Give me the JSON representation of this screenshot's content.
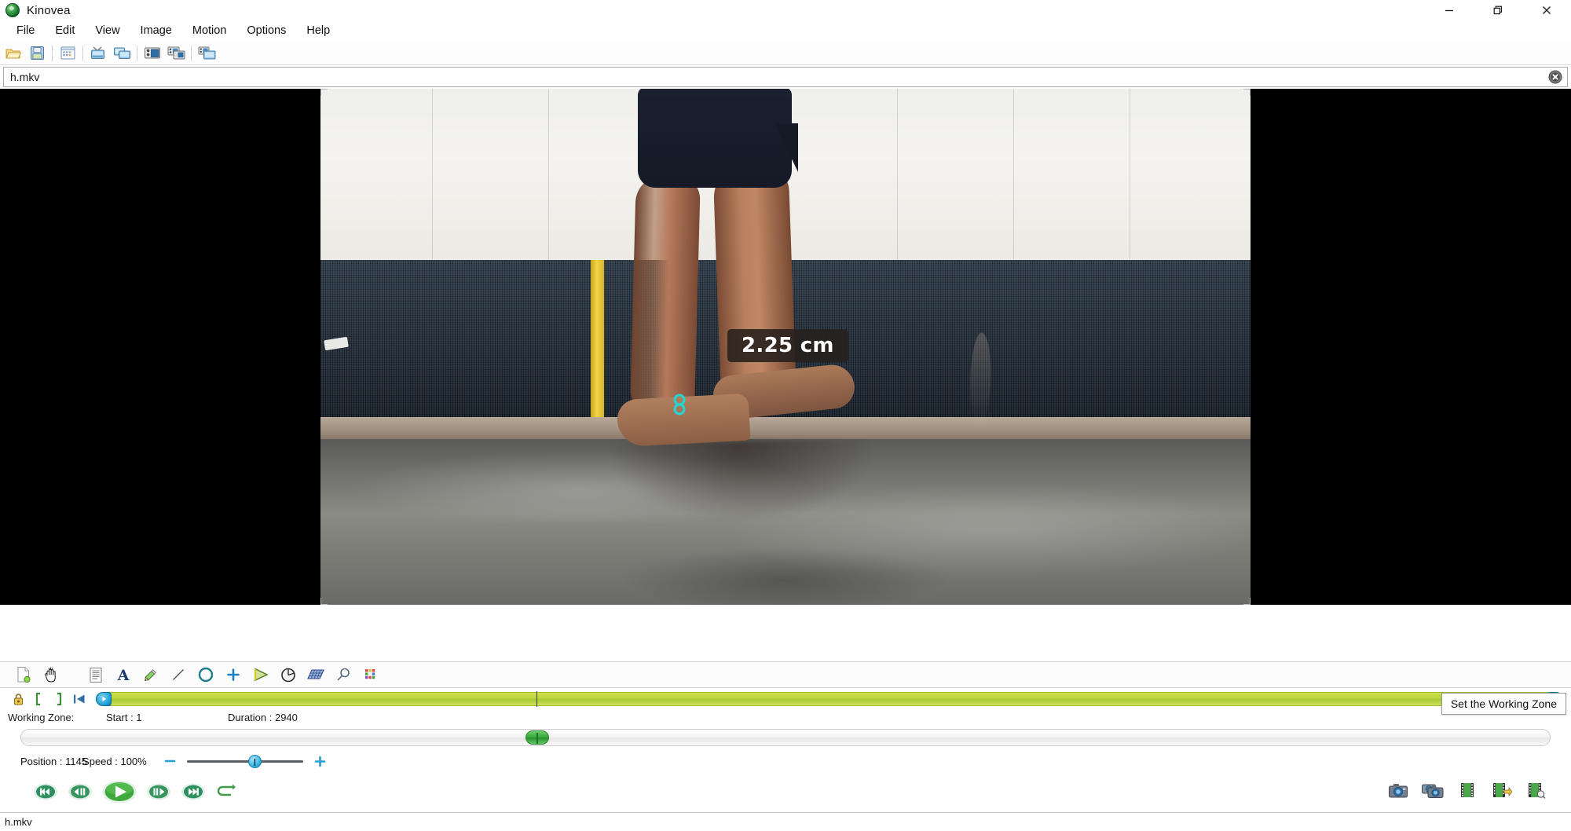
{
  "window": {
    "app_title": "Kinovea",
    "logo_icon": "kinovea-logo-icon",
    "minimize_icon": "minimize-icon",
    "restore_icon": "restore-icon",
    "close_icon": "close-icon"
  },
  "menu": {
    "items": [
      {
        "label": "File",
        "name": "menu-file"
      },
      {
        "label": "Edit",
        "name": "menu-edit"
      },
      {
        "label": "View",
        "name": "menu-view"
      },
      {
        "label": "Image",
        "name": "menu-image"
      },
      {
        "label": "Motion",
        "name": "menu-motion"
      },
      {
        "label": "Options",
        "name": "menu-options"
      },
      {
        "label": "Help",
        "name": "menu-help"
      }
    ]
  },
  "toolbar": {
    "buttons": [
      {
        "name": "open-file-button",
        "icon": "folder-open-icon"
      },
      {
        "name": "save-button",
        "icon": "floppy-disk-icon"
      },
      {
        "name": "file-explorer-button",
        "icon": "window-grid-icon"
      },
      {
        "name": "one-playback-screen-button",
        "icon": "single-screen-icon"
      },
      {
        "name": "two-playback-screens-button",
        "icon": "dual-screen-icon"
      },
      {
        "name": "capture-screen-button",
        "icon": "capture-screen-icon"
      },
      {
        "name": "two-capture-screens-button",
        "icon": "dual-capture-screen-icon"
      },
      {
        "name": "mixed-screens-button",
        "icon": "mixed-screen-icon"
      }
    ]
  },
  "file_bar": {
    "filename": "h.mkv",
    "close_icon": "close-circle-icon"
  },
  "video": {
    "measurement_label": "2.25 cm",
    "marker_icon": "measure-point-icon",
    "scene_description": "side view of bare feet on wet concrete floor, tiled wall behind"
  },
  "drawing_tools": [
    {
      "name": "tool-new-drawing",
      "icon": "page-add-icon"
    },
    {
      "name": "tool-hand",
      "icon": "hand-icon"
    },
    {
      "name": "tool-comment",
      "icon": "note-icon"
    },
    {
      "name": "tool-label",
      "icon": "text-a-icon"
    },
    {
      "name": "tool-pencil",
      "icon": "pencil-icon"
    },
    {
      "name": "tool-line",
      "icon": "line-icon"
    },
    {
      "name": "tool-circle",
      "icon": "circle-icon"
    },
    {
      "name": "tool-crossmark",
      "icon": "plus-cross-icon"
    },
    {
      "name": "tool-angle",
      "icon": "angle-icon"
    },
    {
      "name": "tool-circle-angle",
      "icon": "circular-angle-icon"
    },
    {
      "name": "tool-plane",
      "icon": "grid-plane-icon"
    },
    {
      "name": "tool-magnifier",
      "icon": "magnifier-icon"
    },
    {
      "name": "tool-toolpresets",
      "icon": "color-palette-icon"
    }
  ],
  "working_zone": {
    "lock_icon": "padlock-icon",
    "set_start_icon": "bracket-left-icon",
    "set_end_icon": "bracket-right-icon",
    "reset_icon": "rewind-to-start-icon",
    "label": "Working Zone:",
    "start_label": "Start : 1",
    "duration_label": "Duration : 2940",
    "tooltip": "Set the Working Zone",
    "bar_fill_color": "#b9d43a",
    "handle_color": "#199ed4",
    "playhead_percent": 30
  },
  "position": {
    "track_percent": 33,
    "position_label": "Position : 1145",
    "speed_label": "Speed : 100%",
    "speed_slider_percent": 53,
    "decrease_icon": "minus-icon",
    "increase_icon": "plus-icon",
    "handle_color": "#36a83a"
  },
  "playback": {
    "buttons": [
      {
        "name": "first-frame-button",
        "icon": "skip-back-icon"
      },
      {
        "name": "previous-frame-button",
        "icon": "step-back-icon"
      },
      {
        "name": "play-button",
        "icon": "play-icon"
      },
      {
        "name": "next-frame-button",
        "icon": "step-forward-icon"
      },
      {
        "name": "last-frame-button",
        "icon": "skip-forward-icon"
      },
      {
        "name": "loop-button",
        "icon": "loop-arrow-icon"
      }
    ]
  },
  "export": {
    "buttons": [
      {
        "name": "save-key-image-button",
        "icon": "camera-icon"
      },
      {
        "name": "save-image-sequence-button",
        "icon": "dual-camera-icon"
      },
      {
        "name": "save-video-button",
        "icon": "film-strip-icon"
      },
      {
        "name": "save-video-with-pauses-button",
        "icon": "film-strip-export-icon"
      },
      {
        "name": "save-diaporama-button",
        "icon": "film-strip-search-icon"
      }
    ]
  },
  "status_bar": {
    "text": "h.mkv"
  }
}
